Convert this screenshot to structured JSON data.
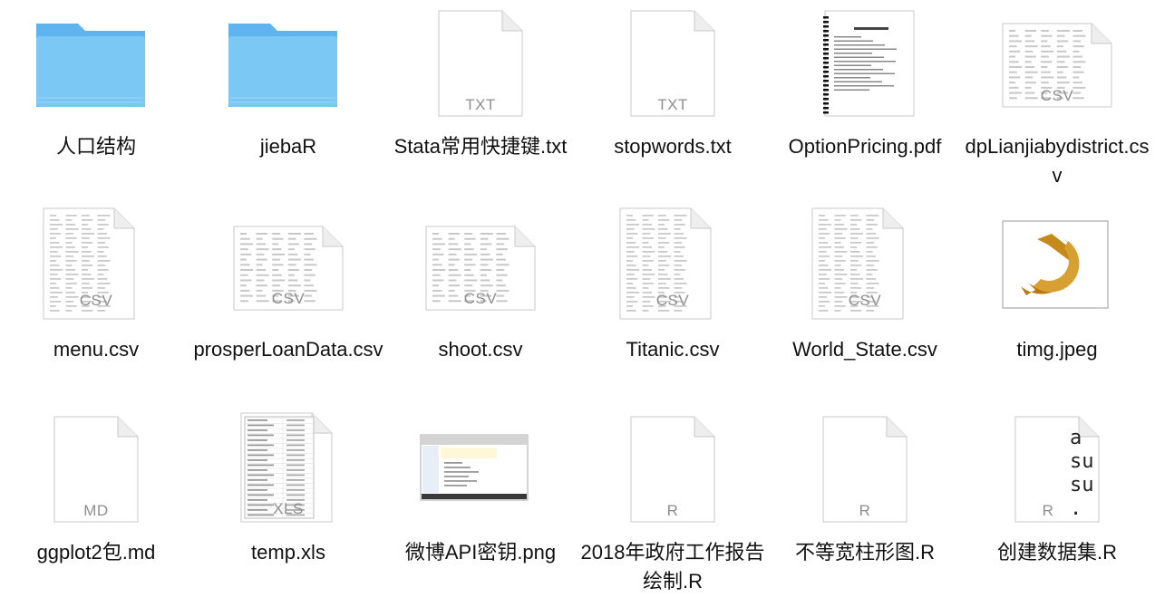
{
  "colors": {
    "folder_front": "#7cc8f5",
    "folder_back": "#5fb4ef",
    "doc_fill": "#ffffff",
    "doc_stroke": "#c9c9c9",
    "ext_text": "#8e8e8e",
    "label_text": "#111111"
  },
  "files": [
    {
      "name": "人口结构",
      "kind": "folder",
      "icon": "folder-icon"
    },
    {
      "name": "jiebaR",
      "kind": "folder",
      "icon": "folder-icon"
    },
    {
      "name": "Stata常用快捷键.txt",
      "kind": "doc",
      "ext": "TXT",
      "icon": "text-file-icon"
    },
    {
      "name": "stopwords.txt",
      "kind": "doc",
      "ext": "TXT",
      "icon": "text-file-icon"
    },
    {
      "name": "OptionPricing.pdf",
      "kind": "pdf",
      "icon": "pdf-preview-icon"
    },
    {
      "name": "dpLianjiabydistrict.csv",
      "kind": "csvwide",
      "ext": "CSV",
      "icon": "spreadsheet-file-icon"
    },
    {
      "name": "menu.csv",
      "kind": "csvtall",
      "ext": "CSV",
      "icon": "spreadsheet-file-icon"
    },
    {
      "name": "prosperLoanData.csv",
      "kind": "csvwide",
      "ext": "CSV",
      "icon": "spreadsheet-file-icon"
    },
    {
      "name": "shoot.csv",
      "kind": "csvwide",
      "ext": "CSV",
      "icon": "spreadsheet-file-icon"
    },
    {
      "name": "Titanic.csv",
      "kind": "csvtall",
      "ext": "CSV",
      "icon": "spreadsheet-file-icon"
    },
    {
      "name": "World_State.csv",
      "kind": "csvtall",
      "ext": "CSV",
      "icon": "spreadsheet-file-icon"
    },
    {
      "name": "timg.jpeg",
      "kind": "image",
      "icon": "hammer-sickle-image-icon"
    },
    {
      "name": "ggplot2包.md",
      "kind": "doc",
      "ext": "MD",
      "icon": "markdown-file-icon"
    },
    {
      "name": "temp.xls",
      "kind": "xls",
      "ext": "XLS",
      "icon": "excel-file-icon"
    },
    {
      "name": "微博API密钥.png",
      "kind": "screenshot",
      "icon": "screenshot-image-icon"
    },
    {
      "name": "2018年政府工作报告绘制.R",
      "kind": "doc",
      "ext": "R",
      "icon": "r-script-file-icon"
    },
    {
      "name": "不等宽柱形图.R",
      "kind": "doc",
      "ext": "R",
      "icon": "r-script-file-icon"
    },
    {
      "name": "创建数据集.R",
      "kind": "rtext",
      "ext": "R",
      "preview_lines": [
        "a",
        "su",
        "su",
        "."
      ],
      "icon": "r-script-file-icon"
    }
  ]
}
